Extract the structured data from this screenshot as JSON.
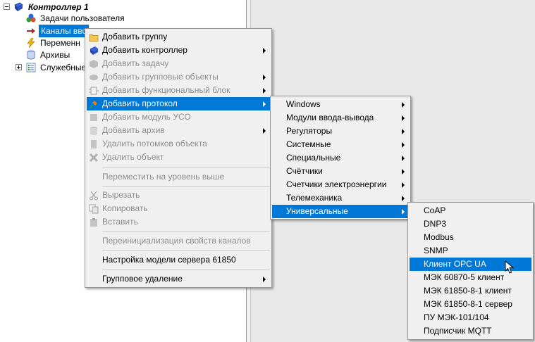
{
  "tree": {
    "items": [
      {
        "label": "Контроллер 1"
      },
      {
        "label": "Задачи пользователя"
      },
      {
        "label": "Каналы вво"
      },
      {
        "label": "Переменн"
      },
      {
        "label": "Архивы"
      },
      {
        "label": "Служебные"
      }
    ]
  },
  "context_menu": {
    "items": [
      {
        "label": "Добавить группу"
      },
      {
        "label": "Добавить контроллер"
      },
      {
        "label": "Добавить задачу"
      },
      {
        "label": "Добавить групповые объекты"
      },
      {
        "label": "Добавить функциональный блок"
      },
      {
        "label": "Добавить протокол"
      },
      {
        "label": "Добавить модуль УСО"
      },
      {
        "label": "Добавить архив"
      },
      {
        "label": "Удалить потомков объекта"
      },
      {
        "label": "Удалить объект"
      },
      {
        "label": "Переместить на уровень выше"
      },
      {
        "label": "Вырезать"
      },
      {
        "label": "Копировать"
      },
      {
        "label": "Вставить"
      },
      {
        "label": "Переинициализация свойств каналов"
      },
      {
        "label": "Настройка модели сервера 61850"
      },
      {
        "label": "Групповое удаление"
      }
    ]
  },
  "protocol_submenu": {
    "items": [
      {
        "label": "Windows"
      },
      {
        "label": "Модули ввода-вывода"
      },
      {
        "label": "Регуляторы"
      },
      {
        "label": "Системные"
      },
      {
        "label": "Специальные"
      },
      {
        "label": "Счётчики"
      },
      {
        "label": "Счетчики электроэнергии"
      },
      {
        "label": "Телемеханика"
      },
      {
        "label": "Универсальные"
      }
    ]
  },
  "universal_submenu": {
    "items": [
      {
        "label": "CoAP"
      },
      {
        "label": "DNP3"
      },
      {
        "label": "Modbus"
      },
      {
        "label": "SNMP"
      },
      {
        "label": "Клиент OPC UA"
      },
      {
        "label": "МЭК 60870-5 клиент"
      },
      {
        "label": "МЭК 61850-8-1 клиент"
      },
      {
        "label": "МЭК 61850-8-1 сервер"
      },
      {
        "label": "ПУ МЭК-101/104"
      },
      {
        "label": "Подписчик MQTT"
      }
    ]
  },
  "colors": {
    "highlight": "#0078d7",
    "menu_bg": "#f0f0f0",
    "disabled_text": "#8d8d8d"
  }
}
